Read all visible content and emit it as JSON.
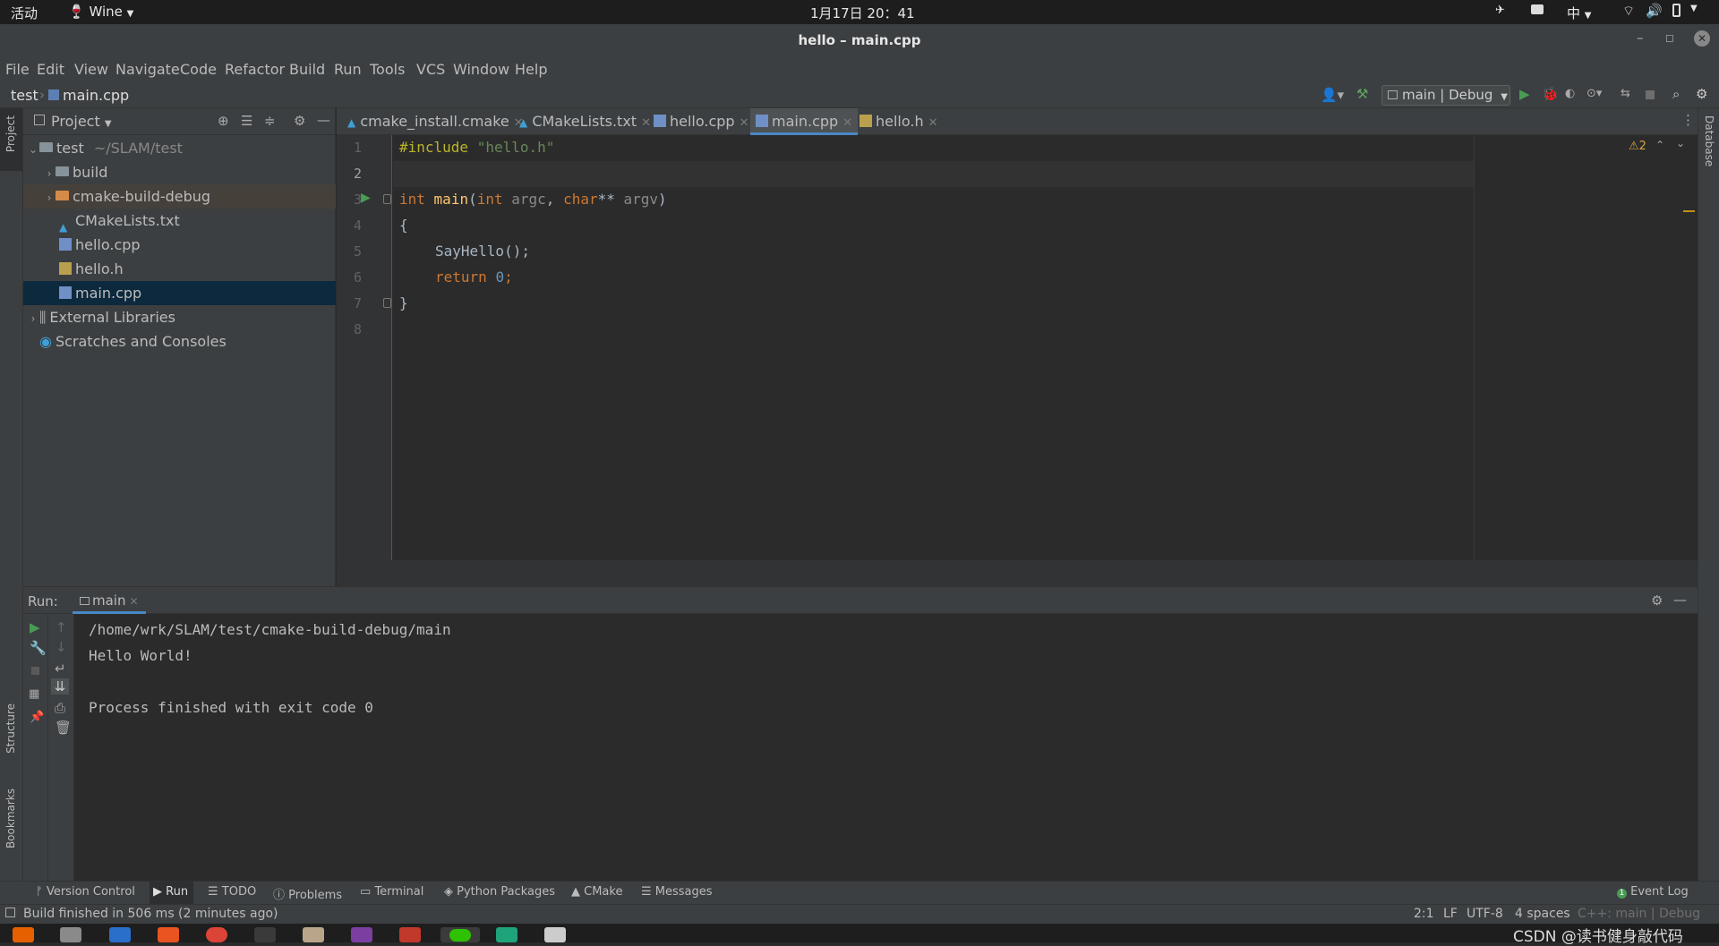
{
  "topbar": {
    "activities": "活动",
    "app": "Wine",
    "datetime": "1月17日  20：41",
    "ime": "中"
  },
  "window": {
    "title": "hello – main.cpp"
  },
  "menu": [
    "File",
    "Edit",
    "View",
    "Navigate",
    "Code",
    "Refactor",
    "Build",
    "Run",
    "Tools",
    "VCS",
    "Window",
    "Help"
  ],
  "breadcrumb": {
    "project": "test",
    "file": "main.cpp"
  },
  "run_config": "main | Debug",
  "project_panel": {
    "title": "Project",
    "root": {
      "name": "test",
      "path": "~/SLAM/test"
    },
    "items": [
      {
        "name": "build"
      },
      {
        "name": "cmake-build-debug"
      },
      {
        "name": "CMakeLists.txt"
      },
      {
        "name": "hello.cpp"
      },
      {
        "name": "hello.h"
      },
      {
        "name": "main.cpp"
      }
    ],
    "external": "External Libraries",
    "scratches": "Scratches and Consoles"
  },
  "tabs": [
    "cmake_install.cmake",
    "CMakeLists.txt",
    "hello.cpp",
    "main.cpp",
    "hello.h"
  ],
  "inspection": {
    "warnings": "2"
  },
  "editor": {
    "line_numbers": [
      "1",
      "2",
      "3",
      "4",
      "5",
      "6",
      "7",
      "8"
    ],
    "include_kw": "#include",
    "include_str": "\"hello.h\"",
    "int1": "int",
    "main_fn": "main",
    "paren_open": "(",
    "int2": "int",
    "argc": "argc",
    "comma": ", ",
    "char_kw": "char",
    "stars": "**",
    "argv": "argv",
    "paren_close": ")",
    "brace_open": "{",
    "call": "SayHello();",
    "return_kw": "return",
    "zero": "0",
    "semicolon": ";",
    "brace_close": "}"
  },
  "run": {
    "label": "Run:",
    "tab": "main",
    "output": [
      "/home/wrk/SLAM/test/cmake-build-debug/main",
      "Hello World!",
      "",
      "Process finished with exit code 0"
    ]
  },
  "side_labels": {
    "project": "Project",
    "structure": "Structure",
    "bookmarks": "Bookmarks",
    "database": "Database"
  },
  "bottom_tabs": [
    "Version Control",
    "Run",
    "TODO",
    "Problems",
    "Terminal",
    "Python Packages",
    "CMake",
    "Messages"
  ],
  "event_log": "Event Log",
  "status": {
    "message": "Build finished in 506 ms (2 minutes ago)",
    "position": "2:1",
    "line_sep": "LF",
    "encoding": "UTF-8",
    "indent": "4 spaces",
    "context": "C++: main | Debug"
  },
  "watermark": "CSDN @读书健身敲代码"
}
